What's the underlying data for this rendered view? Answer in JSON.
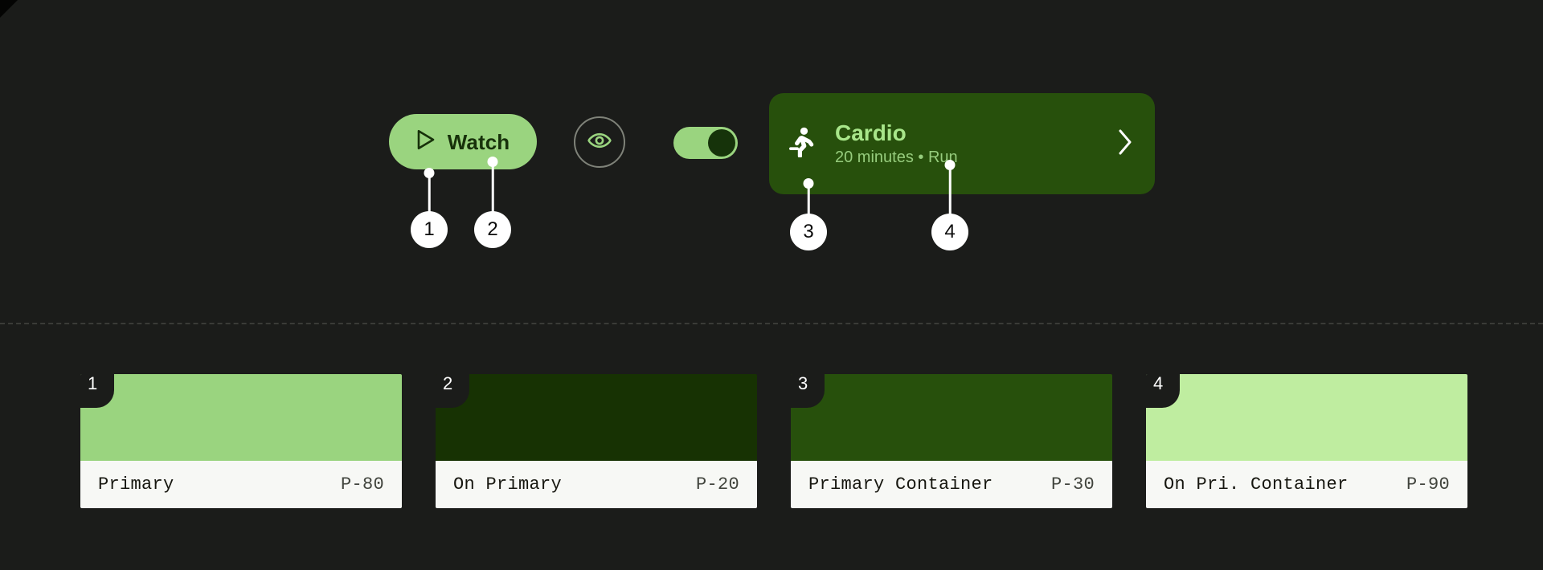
{
  "canvas": {
    "background": "#1b1c1a",
    "divider_color": "#3a3b37"
  },
  "showcase": {
    "watch_button": {
      "label": "Watch",
      "icon": "play-triangle-icon",
      "background": "#9ad47f",
      "text_color": "#17310a"
    },
    "eye_button": {
      "icon": "eye-icon",
      "icon_color": "#9ad47f",
      "ring_color": "#7f8279"
    },
    "toggle_switch": {
      "state": "on",
      "track_color": "#9ad47f",
      "thumb_color": "#16330a"
    },
    "cardio_card": {
      "title": "Cardio",
      "subtitle": "20 minutes • Run",
      "leading_icon": "running-person-icon",
      "trailing_icon": "chevron-right-icon",
      "background": "#27500c",
      "title_color": "#a8e68a",
      "subtitle_color": "#96cc7d"
    }
  },
  "callouts": [
    {
      "number": "1",
      "target": "watch-button-background"
    },
    {
      "number": "2",
      "target": "watch-button-label"
    },
    {
      "number": "3",
      "target": "cardio-card-background"
    },
    {
      "number": "4",
      "target": "cardio-card-subtitle"
    }
  ],
  "swatches": [
    {
      "badge": "1",
      "name": "Primary",
      "token": "P-80",
      "color": "#9ad47f"
    },
    {
      "badge": "2",
      "name": "On Primary",
      "token": "P-20",
      "color": "#173203"
    },
    {
      "badge": "3",
      "name": "Primary Container",
      "token": "P-30",
      "color": "#27500c"
    },
    {
      "badge": "4",
      "name": "On Pri. Container",
      "token": "P-90",
      "color": "#bfeda0"
    }
  ]
}
